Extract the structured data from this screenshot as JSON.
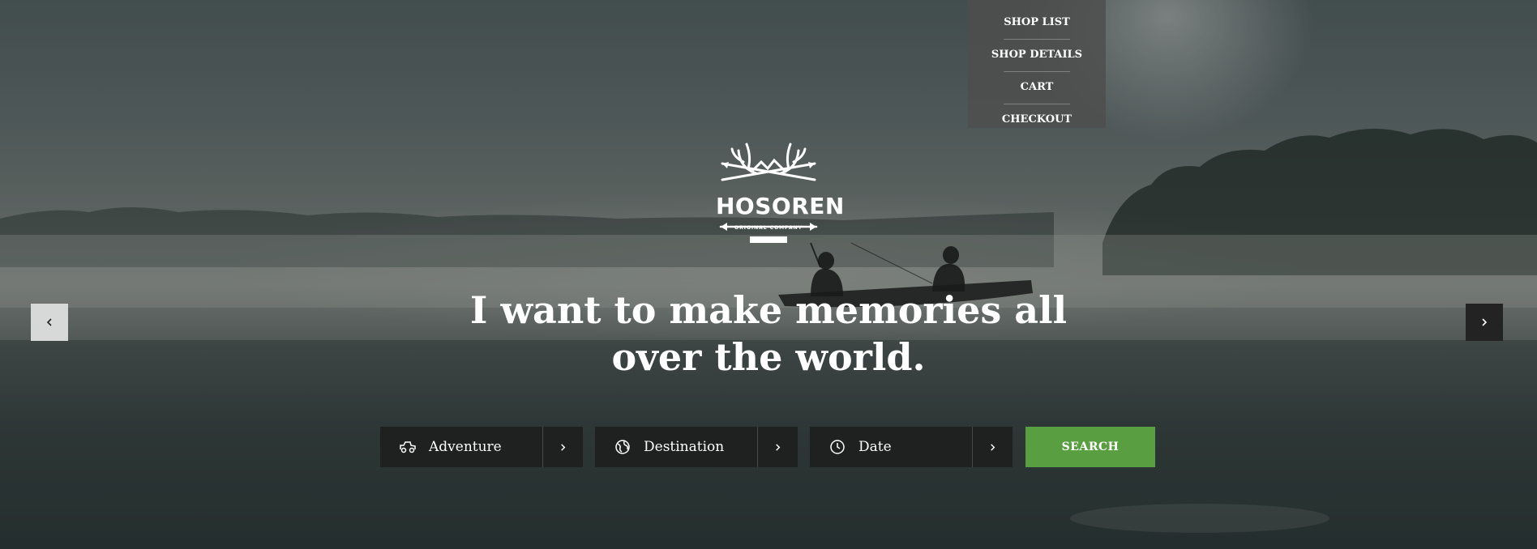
{
  "dropdown": {
    "items": [
      {
        "label": "SHOP LIST"
      },
      {
        "label": "SHOP DETAILS"
      },
      {
        "label": "CART"
      },
      {
        "label": "CHECKOUT"
      }
    ]
  },
  "logo": {
    "name": "HOSOREN",
    "tagline": "ORIGINAL COMPANY",
    "icon": "antlers-arrows-icon"
  },
  "hero": {
    "headline_line1": "I want to make memories all",
    "headline_line2": "over the world."
  },
  "slider": {
    "prev_icon": "chevron-left-icon",
    "next_icon": "chevron-right-icon"
  },
  "search": {
    "fields": [
      {
        "label": "Adventure",
        "icon": "jeep-icon"
      },
      {
        "label": "Destination",
        "icon": "globe-icon"
      },
      {
        "label": "Date",
        "icon": "clock-icon"
      }
    ],
    "button_label": "SEARCH",
    "button_color": "#5a9e42"
  }
}
